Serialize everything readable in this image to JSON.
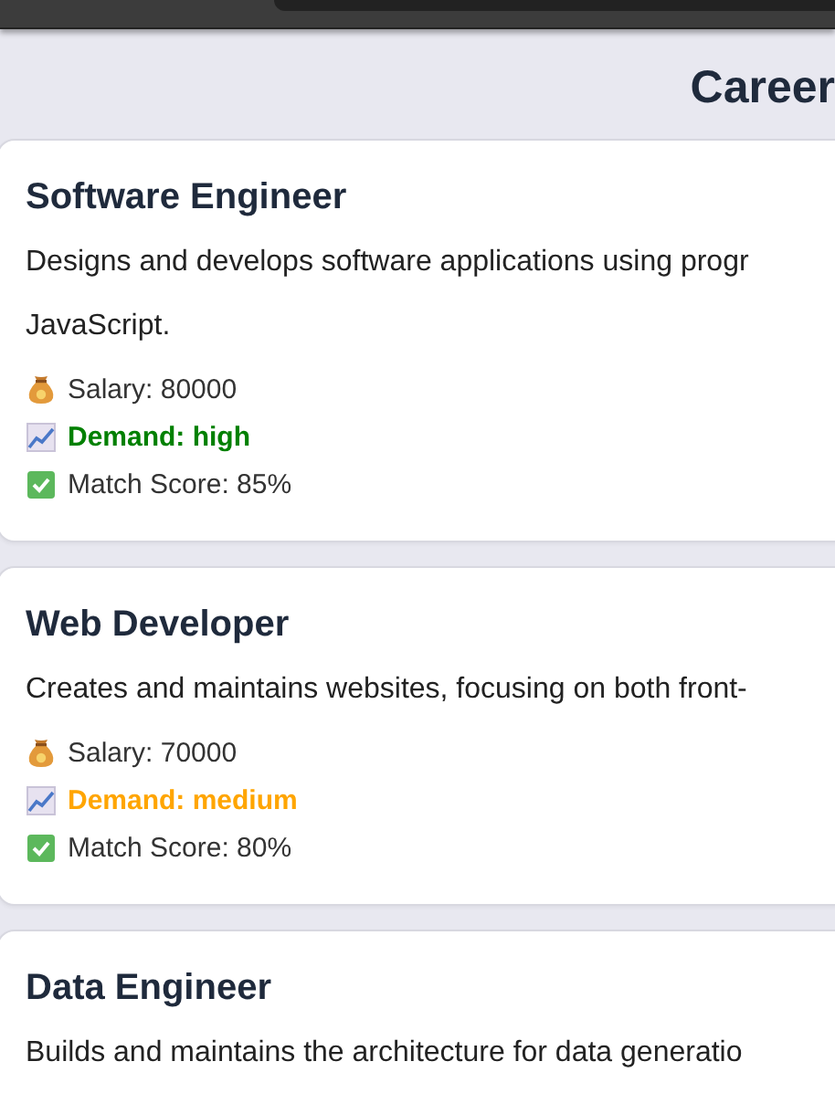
{
  "title": "Career",
  "careers": [
    {
      "name": "Software Engineer",
      "description": [
        "Designs and develops software applications using progr",
        "JavaScript."
      ],
      "details": [
        {
          "kind": "salary",
          "text": "Salary: 80000"
        },
        {
          "kind": "demand",
          "text": "Demand: high",
          "color": "#008000"
        },
        {
          "kind": "match",
          "text": "Match Score: 85%"
        }
      ]
    },
    {
      "name": "Web Developer",
      "description": [
        "Creates and maintains websites, focusing on both front-"
      ],
      "details": [
        {
          "kind": "salary",
          "text": "Salary: 70000"
        },
        {
          "kind": "demand",
          "text": "Demand: medium",
          "color": "#ffa500"
        },
        {
          "kind": "match",
          "text": "Match Score: 80%"
        }
      ]
    },
    {
      "name": "Data Engineer",
      "description": [
        "Builds and maintains the architecture for data generatio"
      ]
    }
  ]
}
